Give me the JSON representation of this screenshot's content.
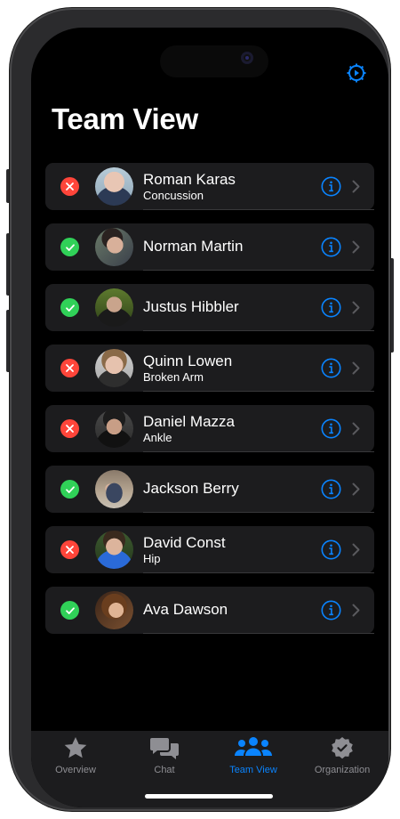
{
  "header": {
    "title": "Team View"
  },
  "roster": [
    {
      "name": "Roman Karas",
      "detail": "Concussion",
      "status": "injured"
    },
    {
      "name": "Norman Martin",
      "detail": "",
      "status": "available"
    },
    {
      "name": "Justus Hibbler",
      "detail": "",
      "status": "available"
    },
    {
      "name": "Quinn Lowen",
      "detail": "Broken Arm",
      "status": "injured"
    },
    {
      "name": "Daniel Mazza",
      "detail": "Ankle",
      "status": "injured"
    },
    {
      "name": "Jackson Berry",
      "detail": "",
      "status": "available"
    },
    {
      "name": "David Const",
      "detail": "Hip",
      "status": "injured"
    },
    {
      "name": "Ava Dawson",
      "detail": "",
      "status": "available"
    }
  ],
  "tabs": [
    {
      "label": "Overview",
      "icon": "star-icon",
      "active": false
    },
    {
      "label": "Chat",
      "icon": "chat-bubbles-icon",
      "active": false
    },
    {
      "label": "Team View",
      "icon": "people-icon",
      "active": true
    },
    {
      "label": "Organization",
      "icon": "verified-badge-icon",
      "active": false
    }
  ],
  "colors": {
    "accent": "#0a84ff",
    "available": "#30d158",
    "injured": "#ff453a",
    "row_background": "#1c1c1e"
  }
}
